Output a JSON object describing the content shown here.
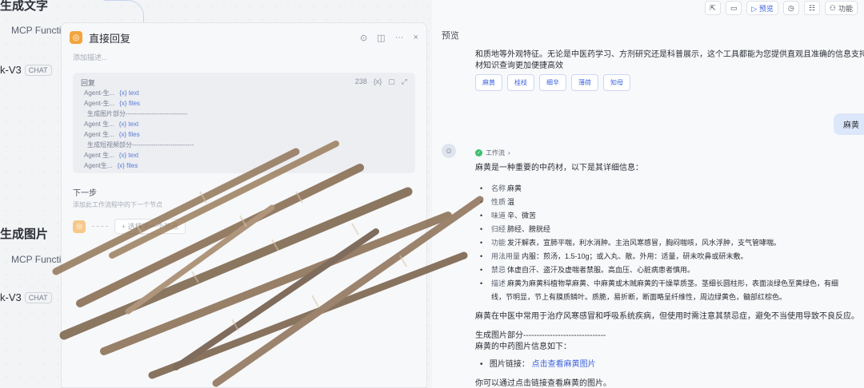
{
  "canvas": {
    "node_top_title": "生成文字",
    "mcp_label_1": "MCP Functi",
    "model_label_1": "k-V3",
    "chat_tag_1": "CHAT",
    "node_mid_title": "生成图片",
    "mcp_label_2": "MCP Functi",
    "model_label_2": "k-V3",
    "chat_tag_2": "CHAT"
  },
  "panel": {
    "icon_glyph": "◎",
    "title": "直接回复",
    "add_description": "添加描述...",
    "editor_label": "回复",
    "char_count": "238",
    "var_icon": "{x}",
    "lines": [
      {
        "node": "Agent-生...",
        "var": "{x} text"
      },
      {
        "node": "Agent-生...",
        "var": "{x} files"
      },
      {
        "node": "生成图片部分-----------------------------",
        "var": ""
      },
      {
        "node": "Agent 生...",
        "var": "{x} text"
      },
      {
        "node": "Agent 生...",
        "var": "{x} files"
      },
      {
        "node": "生成短视频部分-----------------------------",
        "var": ""
      },
      {
        "node": "Agent 生...",
        "var": "{x} text"
      },
      {
        "node": "Agent生...",
        "var": "{x} files"
      }
    ],
    "next_title": "下一步",
    "next_desc": "添加此工作流程中的下一个节点",
    "select_next": "+ 选择下一个节点"
  },
  "preview": {
    "label": "预览",
    "toolbar": {
      "run_label": "▷ 预览",
      "feature_label": "功能"
    },
    "intro_line_1": "和质地等外观特征。无论是中医药学习、方剂研究还是科普展示，这个工具都能为您提供直观且准确的信息支持，让",
    "intro_line_2": "材知识查询更加便捷高效",
    "chips": [
      "麻黄",
      "桂枝",
      "细辛",
      "薄荷",
      "知母"
    ],
    "user_message": "麻黄",
    "bot_avatar": "☺",
    "workflow_label": "工作流",
    "answer_intro": "麻黄是一种重要的中药材，以下是其详细信息：",
    "items": [
      {
        "label": "名称",
        "text": "麻黄"
      },
      {
        "label": "性质",
        "text": "温"
      },
      {
        "label": "味道",
        "text": "辛、微苦"
      },
      {
        "label": "归经",
        "text": "肺经、膀胱经"
      },
      {
        "label": "功能",
        "text": "发汗解表，宣肺平喘，利水消肿。主治风寒感冒，胸闷喘咳，风水浮肿，支气管哮喘。"
      },
      {
        "label": "用法用量",
        "text": "内服：煎汤，1.5-10g；或入丸、散。外用：适量，研末吹鼻或研末敷。"
      },
      {
        "label": "禁忌",
        "text": "体虚自汗、盗汗及虚喘者禁服。高血压、心脏病患者慎用。"
      },
      {
        "label": "描述",
        "text": "麻黄为麻黄科植物草麻黄、中麻黄或木贼麻黄的干燥草质茎。茎细长圆柱形，表面淡绿色至黄绿色，有细"
      }
    ],
    "desc_cont": "线，节明显，节上有膜质鳞叶。质脆，易折断，断面略呈纤维性，周边绿黄色，髓部红棕色。",
    "summary": "麻黄在中医中常用于治疗风寒感冒和呼吸系统疾病，但使用时需注意其禁忌症，避免不当使用导致不良反应。",
    "img_section": "生成图片部分-------------------------------",
    "img_intro": "麻黄的中药图片信息如下：",
    "img_link_label": "图片链接：",
    "img_link_text": "点击查看麻黄图片",
    "footer_line": "你可以通过点击链接查看麻黄的图片。"
  }
}
